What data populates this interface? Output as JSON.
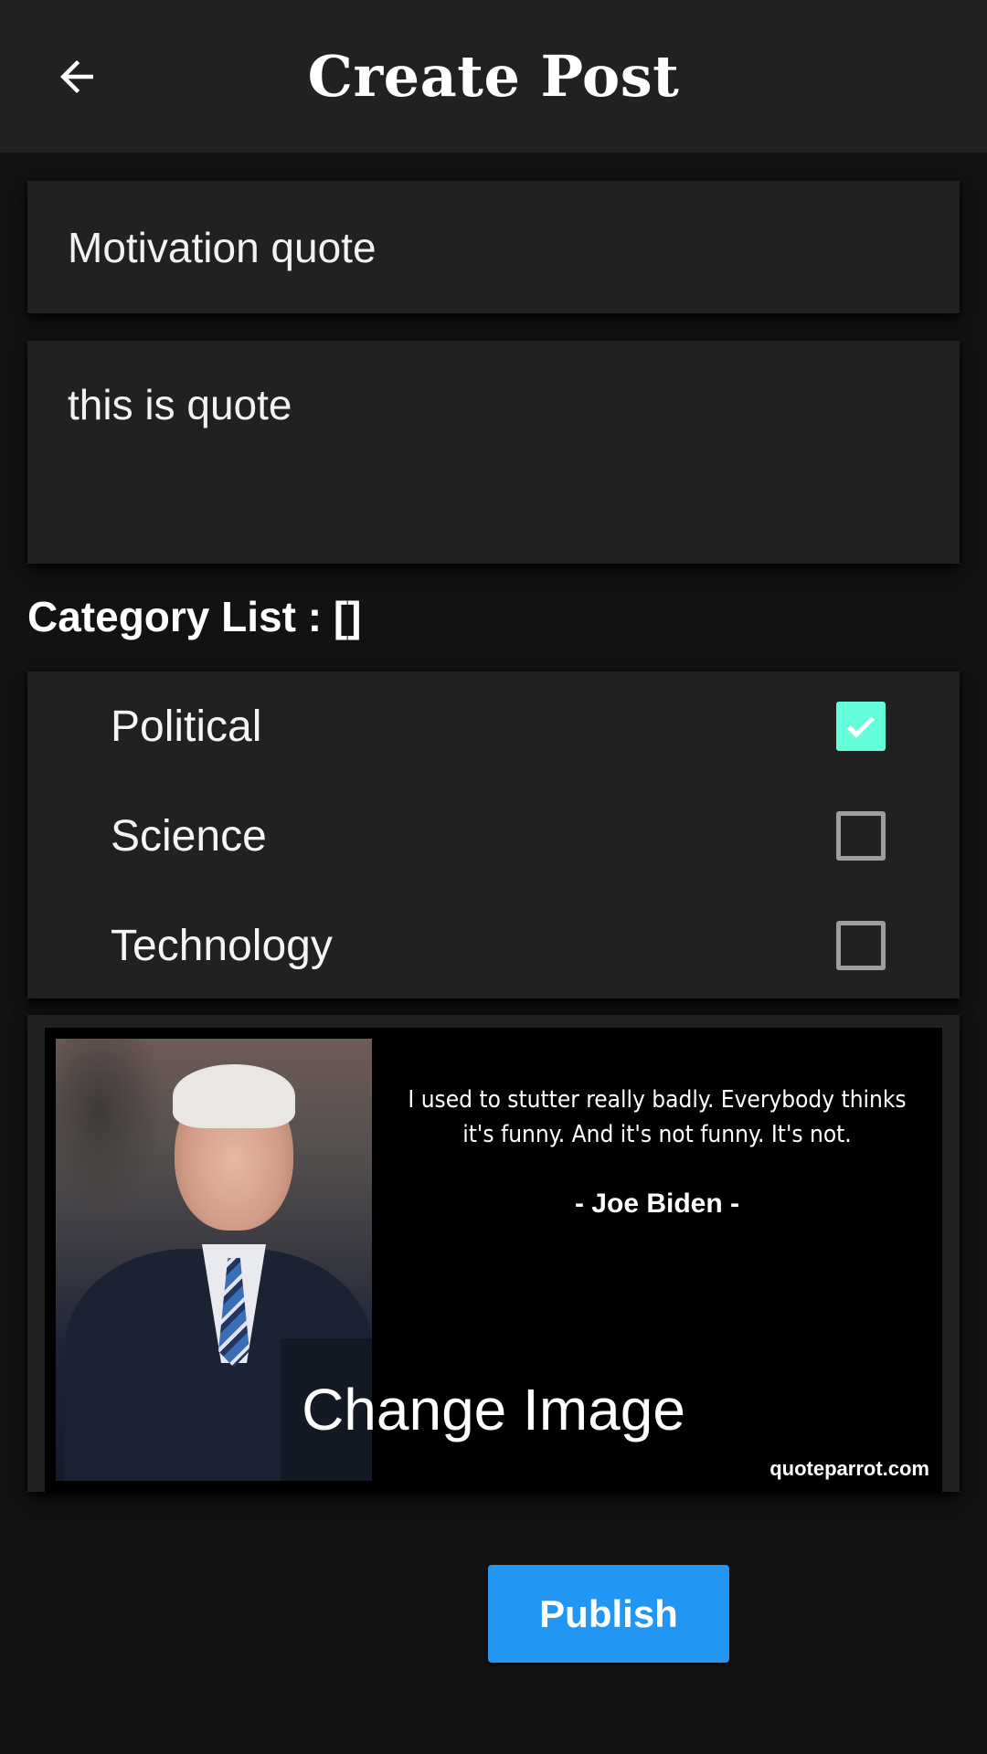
{
  "header": {
    "title": "Create Post",
    "back_icon": "arrow-left-icon"
  },
  "form": {
    "title_value": "Motivation quote",
    "body_value": "this is quote"
  },
  "categories": {
    "heading": "Category List : []",
    "items": [
      {
        "label": "Political",
        "checked": true
      },
      {
        "label": "Science",
        "checked": false
      },
      {
        "label": "Technology",
        "checked": false
      }
    ],
    "check_color": "#64ffda"
  },
  "image": {
    "quote_text": "I used to stutter really badly. Everybody thinks it's funny. And it's not funny. It's not.",
    "quote_author": "- Joe Biden -",
    "watermark": "quoteparrot.com",
    "change_label": "Change Image"
  },
  "actions": {
    "publish_label": "Publish",
    "publish_color": "#2196f3"
  }
}
